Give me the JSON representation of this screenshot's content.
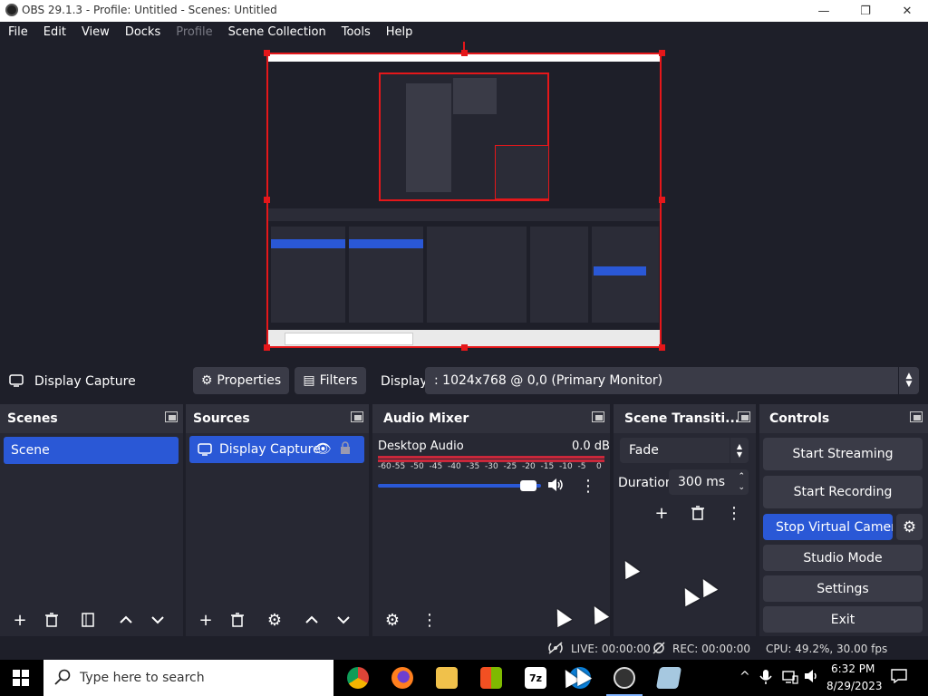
{
  "window": {
    "title": "OBS 29.1.3 - Profile: Untitled - Scenes: Untitled"
  },
  "menu": [
    "File",
    "Edit",
    "View",
    "Docks",
    "Profile",
    "Scene Collection",
    "Tools",
    "Help"
  ],
  "source_toolbar": {
    "source_name": "Display Capture",
    "properties_label": "Properties",
    "filters_label": "Filters",
    "display_label": "Display",
    "display_value": ": 1024x768 @ 0,0 (Primary Monitor)"
  },
  "scenes": {
    "title": "Scenes",
    "items": [
      "Scene"
    ]
  },
  "sources": {
    "title": "Sources",
    "items": [
      "Display Capture"
    ]
  },
  "audio_mixer": {
    "title": "Audio Mixer",
    "channel": "Desktop Audio",
    "level": "0.0 dB",
    "ticks": [
      "-60",
      "-55",
      "-50",
      "-45",
      "-40",
      "-35",
      "-30",
      "-25",
      "-20",
      "-15",
      "-10",
      "-5",
      "0"
    ],
    "volume_fraction": 0.95
  },
  "transitions": {
    "title": "Scene Transiti...",
    "selected": "Fade",
    "duration_label": "Duration",
    "duration_value": "300 ms"
  },
  "controls": {
    "title": "Controls",
    "start_streaming": "Start Streaming",
    "start_recording": "Start Recording",
    "stop_virtual_camera": "Stop Virtual Camera",
    "studio_mode": "Studio Mode",
    "settings": "Settings",
    "exit": "Exit"
  },
  "status": {
    "live": "LIVE: 00:00:00",
    "rec": "REC: 00:00:00",
    "cpu": "CPU: 49.2%, 30.00 fps"
  },
  "taskbar": {
    "search_placeholder": "Type here to search",
    "time": "6:32 PM",
    "date": "8/29/2023"
  },
  "colors": {
    "accent": "#2a58d6",
    "selection_border": "#e5171a",
    "bg": "#1e1f29",
    "dock": "#272833"
  }
}
